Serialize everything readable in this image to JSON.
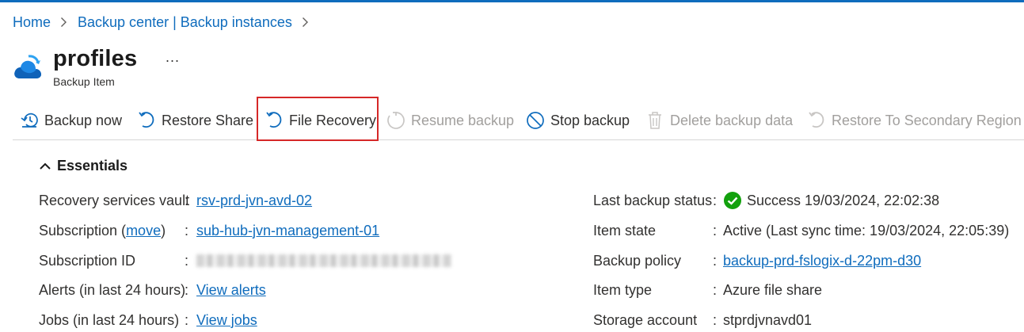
{
  "breadcrumb": {
    "home": "Home",
    "backup_center": "Backup center | Backup instances"
  },
  "header": {
    "title": "profiles",
    "subtitle": "Backup Item",
    "more": "..."
  },
  "toolbar": {
    "backup_now": "Backup now",
    "restore_share": "Restore Share",
    "file_recovery": "File Recovery",
    "resume_backup": "Resume backup",
    "stop_backup": "Stop backup",
    "delete_backup_data": "Delete backup data",
    "restore_secondary": "Restore To Secondary Region"
  },
  "essentials": {
    "header": "Essentials",
    "left": {
      "vault_label": "Recovery services vault",
      "vault_value": "rsv-prd-jvn-avd-02",
      "subscription_label_pre": "Subscription (",
      "subscription_move": "move",
      "subscription_label_post": ")",
      "subscription_value": "sub-hub-jvn-management-01",
      "subscription_id_label": "Subscription ID",
      "alerts_label": "Alerts (in last 24 hours)",
      "alerts_value": "View alerts",
      "jobs_label": "Jobs (in last 24 hours)",
      "jobs_value": "View jobs"
    },
    "right": {
      "last_backup_label": "Last backup status",
      "last_backup_value": "Success 19/03/2024, 22:02:38",
      "item_state_label": "Item state",
      "item_state_value": "Active (Last sync time: 19/03/2024, 22:05:39)",
      "policy_label": "Backup policy",
      "policy_value": "backup-prd-fslogix-d-22pm-d30",
      "item_type_label": "Item type",
      "item_type_value": "Azure file share",
      "storage_label": "Storage account",
      "storage_value": "stprdjvnavd01"
    },
    "colon": ":"
  },
  "colors": {
    "accent": "#0f6cbd",
    "success": "#13a10e",
    "highlight": "#d62828",
    "disabled": "#a19f9d"
  }
}
